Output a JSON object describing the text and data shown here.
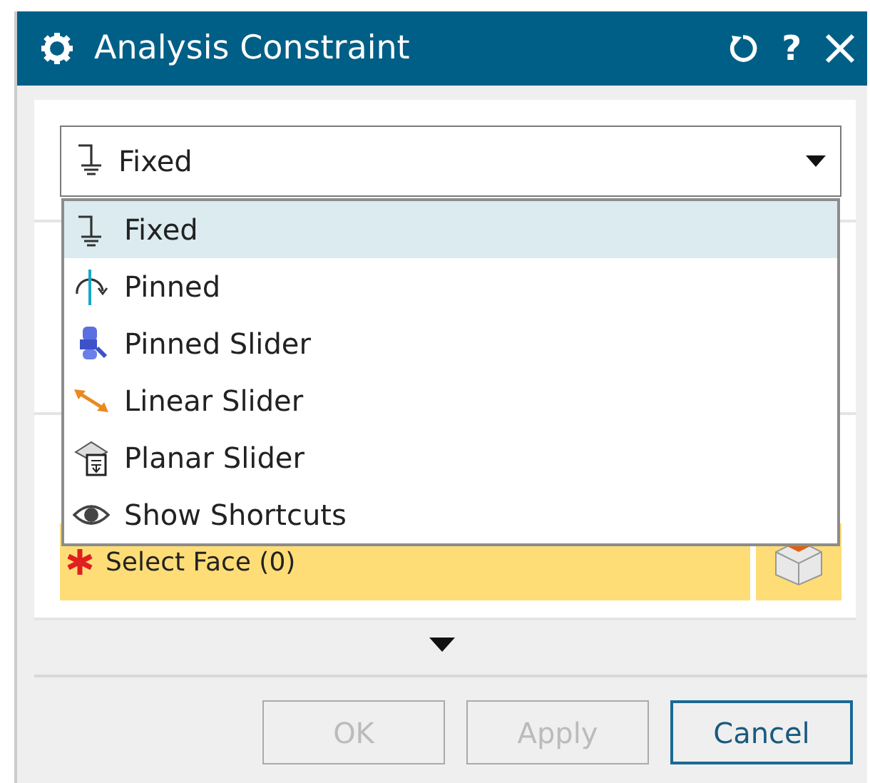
{
  "window": {
    "title": "Analysis Constraint"
  },
  "title_buttons": [
    {
      "kind": "reset"
    },
    {
      "kind": "help",
      "label": "?"
    },
    {
      "kind": "close"
    }
  ],
  "type_dropdown": {
    "value": "Fixed",
    "kind": "fixed",
    "expanded": true
  },
  "type_options": [
    {
      "label": "Fixed",
      "kind": "fixed",
      "selected": true
    },
    {
      "label": "Pinned",
      "kind": "pinned",
      "selected": false
    },
    {
      "label": "Pinned Slider",
      "kind": "cylindrical",
      "selected": false
    },
    {
      "label": "Linear Slider",
      "kind": "linear",
      "selected": false
    },
    {
      "label": "Planar Slider",
      "kind": "planar",
      "selected": false
    },
    {
      "label": "Show Shortcuts",
      "kind": "toggle",
      "selected": false
    }
  ],
  "face_selection": {
    "label": "Select Face (0)"
  },
  "buttons": [
    {
      "label": "OK",
      "disabled": true,
      "default": false
    },
    {
      "label": "Apply",
      "disabled": true,
      "default": false
    },
    {
      "label": "Cancel",
      "disabled": false,
      "default": true
    }
  ]
}
